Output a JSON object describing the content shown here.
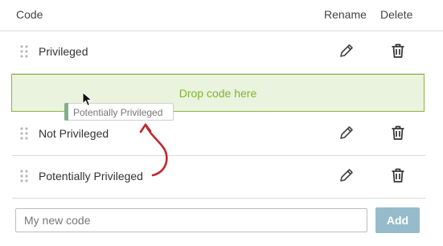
{
  "header": {
    "code": "Code",
    "rename": "Rename",
    "delete": "Delete"
  },
  "codes": [
    {
      "label": "Privileged"
    },
    {
      "label": "Not Privileged"
    },
    {
      "label": "Potentially Privileged"
    }
  ],
  "dropzone": {
    "text": "Drop code here"
  },
  "drag_ghost": {
    "label": "Potentially Privileged"
  },
  "new_code": {
    "placeholder": "My new code",
    "value": ""
  },
  "add_button": {
    "label": "Add"
  },
  "icons": {
    "grip": "drag-grip-icon",
    "rename": "pencil-icon",
    "delete": "trash-icon",
    "cursor": "mouse-pointer-icon",
    "arrow": "curved-arrow-icon"
  },
  "colors": {
    "dropzone_border": "#8cb53b",
    "dropzone_bg": "#eaf3dd",
    "dropzone_text": "#82b42f",
    "add_button_bg": "#96bccb",
    "annotation_arrow": "#c0282f",
    "ghost_bar": "#7fb08a"
  }
}
